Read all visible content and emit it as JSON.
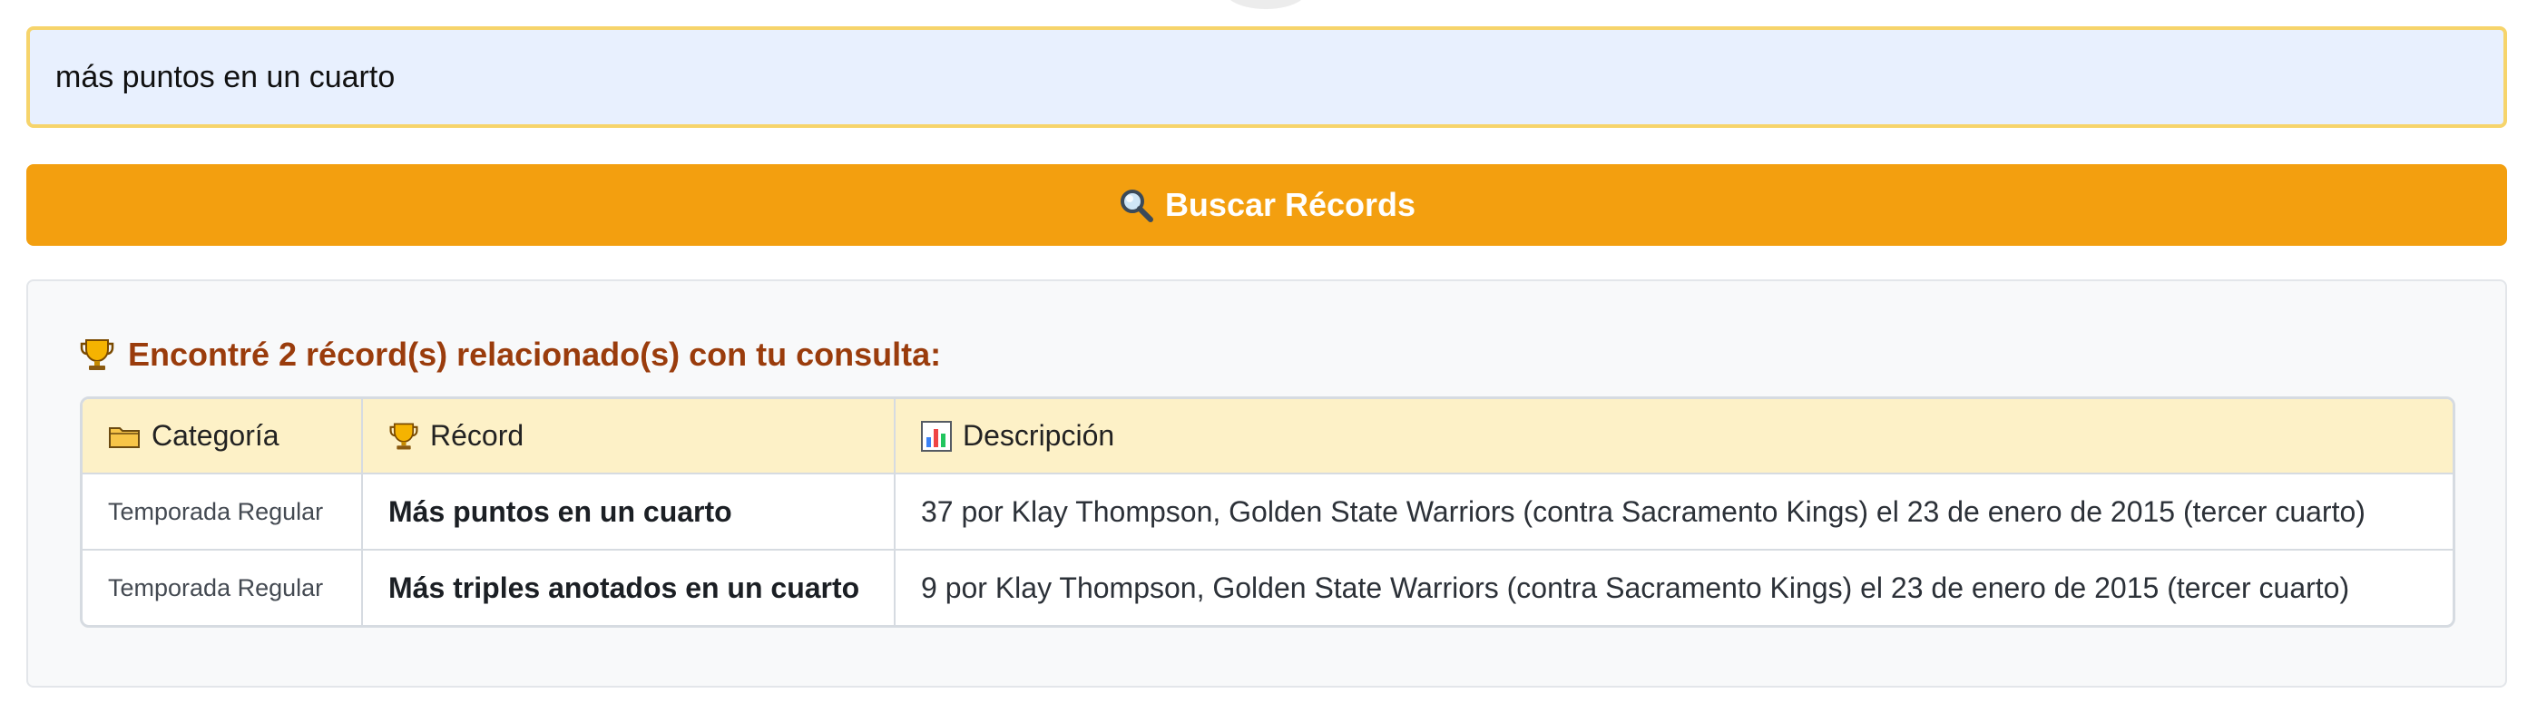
{
  "search": {
    "value": "más puntos en un cuarto"
  },
  "button": {
    "icon": "magnifier-icon",
    "label": "Buscar Récords"
  },
  "results": {
    "heading": "Encontré 2 récord(s) relacionado(s) con tu consulta:",
    "heading_icon": "trophy-icon",
    "columns": [
      {
        "label": "Categoría",
        "icon": "folder-icon"
      },
      {
        "label": "Récord",
        "icon": "trophy-icon"
      },
      {
        "label": "Descripción",
        "icon": "bar-chart-icon"
      }
    ],
    "rows": [
      {
        "category": "Temporada Regular",
        "record": "Más puntos en un cuarto",
        "description": "37 por Klay Thompson, Golden State Warriors (contra Sacramento Kings) el 23 de enero de 2015 (tercer cuarto)"
      },
      {
        "category": "Temporada Regular",
        "record": "Más triples anotados en un cuarto",
        "description": "9 por Klay Thompson, Golden State Warriors (contra Sacramento Kings) el 23 de enero de 2015 (tercer cuarto)"
      }
    ]
  },
  "colors": {
    "button_bg": "#f39f0f",
    "input_bg": "#e8f0fe",
    "input_border": "#f6d46b",
    "heading": "#9a3c0c",
    "table_header_bg": "#fdf1c7"
  }
}
